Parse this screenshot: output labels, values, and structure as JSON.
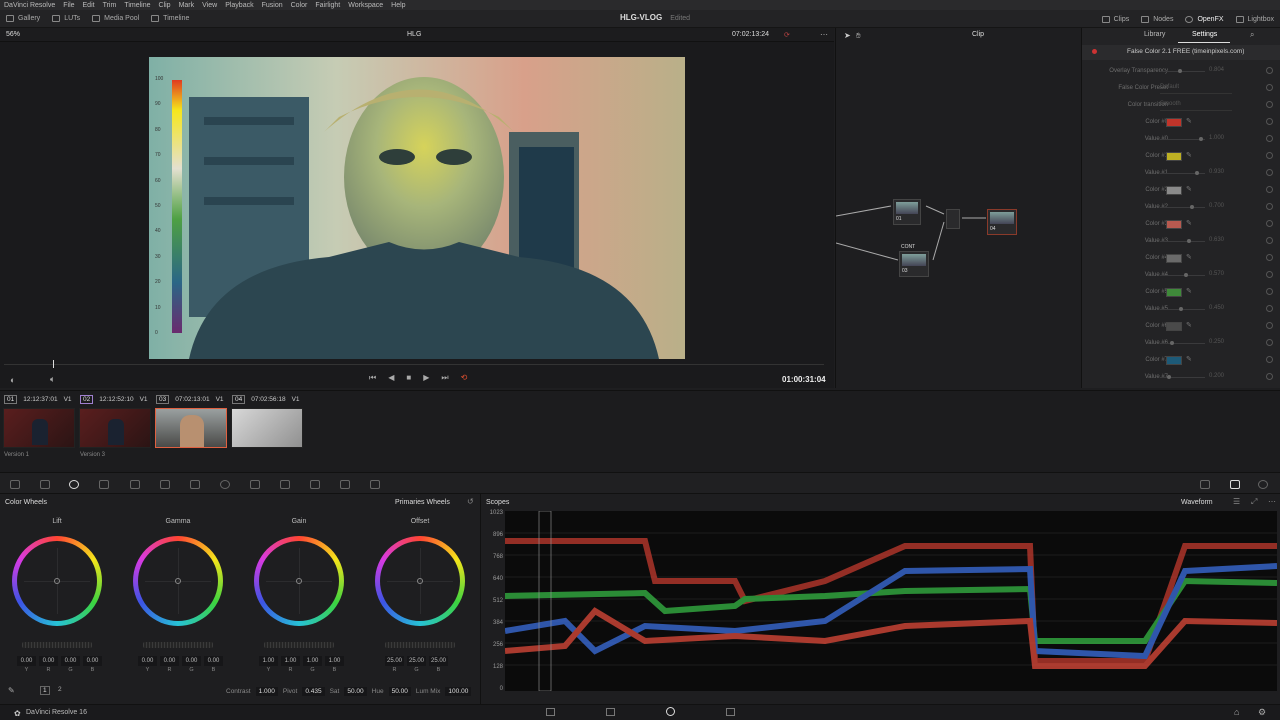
{
  "menu": [
    "DaVinci Resolve",
    "File",
    "Edit",
    "Trim",
    "Timeline",
    "Clip",
    "Mark",
    "View",
    "Playback",
    "Fusion",
    "Color",
    "Fairlight",
    "Workspace",
    "Help"
  ],
  "toolbar": {
    "left": [
      {
        "label": "Gallery",
        "icon": "gallery-icon"
      },
      {
        "label": "LUTs",
        "icon": "luts-icon"
      },
      {
        "label": "Media Pool",
        "icon": "media-pool-icon"
      },
      {
        "label": "Timeline",
        "icon": "timeline-icon"
      }
    ],
    "project_title": "HLG-VLOG",
    "project_status": "Edited",
    "right": [
      {
        "label": "Clips",
        "icon": "clips-icon"
      },
      {
        "label": "Nodes",
        "icon": "nodes-icon"
      },
      {
        "label": "OpenFX",
        "icon": "openfx-icon"
      },
      {
        "label": "Lightbox",
        "icon": "lightbox-icon"
      }
    ]
  },
  "viewer": {
    "zoom": "56%",
    "viewer_label": "HLG",
    "timecode_src": "07:02:13:24",
    "clip_mode": "Clip",
    "timecode": "01:00:31:04",
    "false_color_scale": [
      "100",
      "90",
      "80",
      "70",
      "60",
      "50",
      "40",
      "30",
      "20",
      "10",
      "0"
    ]
  },
  "nodes": {
    "labels": [
      "01",
      "02",
      "03",
      "04"
    ],
    "cont_label": "CONT"
  },
  "openfx": {
    "tabs": [
      "Library",
      "Settings"
    ],
    "plugin": "False Color 2.1 FREE (timeinpixels.com)",
    "rows": [
      {
        "label": "Overlay Transparency",
        "value": "0.804",
        "kind": "slider",
        "pos": 0.45
      },
      {
        "label": "False Color Preset",
        "value": "Default",
        "kind": "select"
      },
      {
        "label": "Color transition",
        "value": "Smooth",
        "kind": "select"
      },
      {
        "label": "Color #0",
        "kind": "color",
        "color": "#c0342a"
      },
      {
        "label": "Value #0",
        "value": "1.000",
        "kind": "slider",
        "pos": 0.9
      },
      {
        "label": "Color #1",
        "kind": "color",
        "color": "#bdb023"
      },
      {
        "label": "Value #1",
        "value": "0.930",
        "kind": "slider",
        "pos": 0.83
      },
      {
        "label": "Color #2",
        "kind": "color",
        "color": "#8a8a8a"
      },
      {
        "label": "Value #2",
        "value": "0.700",
        "kind": "slider",
        "pos": 0.72
      },
      {
        "label": "Color #3",
        "kind": "color",
        "color": "#b85a50"
      },
      {
        "label": "Value #3",
        "value": "0.630",
        "kind": "slider",
        "pos": 0.64
      },
      {
        "label": "Color #4",
        "kind": "color",
        "color": "#6a6a6a"
      },
      {
        "label": "Value #4",
        "value": "0.570",
        "kind": "slider",
        "pos": 0.58
      },
      {
        "label": "Color #5",
        "kind": "color",
        "color": "#3f8a3a"
      },
      {
        "label": "Value #5",
        "value": "0.450",
        "kind": "slider",
        "pos": 0.46
      },
      {
        "label": "Color #6",
        "kind": "color",
        "color": "#4a4a4a"
      },
      {
        "label": "Value #6",
        "value": "0.250",
        "kind": "slider",
        "pos": 0.26
      },
      {
        "label": "Color #7",
        "kind": "color",
        "color": "#1d5a78"
      },
      {
        "label": "Value #7",
        "value": "0.200",
        "kind": "slider",
        "pos": 0.2
      }
    ]
  },
  "clips": [
    {
      "num": "01",
      "tc": "12:12:37:01",
      "track": "V1",
      "version": "Version 1"
    },
    {
      "num": "02",
      "tc": "12:12:52:10",
      "track": "V1",
      "version": "Version 3"
    },
    {
      "num": "03",
      "tc": "07:02:13:01",
      "track": "V1",
      "version": ""
    },
    {
      "num": "04",
      "tc": "07:02:56:18",
      "track": "V1",
      "version": ""
    }
  ],
  "color_wheels": {
    "title": "Color Wheels",
    "mode": "Primaries Wheels",
    "wheels": [
      {
        "name": "Lift",
        "values": [
          "0.00",
          "0.00",
          "0.00",
          "0.00"
        ]
      },
      {
        "name": "Gamma",
        "values": [
          "0.00",
          "0.00",
          "0.00",
          "0.00"
        ]
      },
      {
        "name": "Gain",
        "values": [
          "1.00",
          "1.00",
          "1.00",
          "1.00"
        ]
      },
      {
        "name": "Offset",
        "values": [
          "25.00",
          "25.00",
          "25.00"
        ]
      }
    ],
    "channels": [
      "Y",
      "R",
      "G",
      "B"
    ],
    "channels_offset": [
      "R",
      "G",
      "B"
    ],
    "params": {
      "contrast_label": "Contrast",
      "contrast": "1.000",
      "pivot_label": "Pivot",
      "pivot": "0.435",
      "sat_label": "Sat",
      "sat": "50.00",
      "hue_label": "Hue",
      "hue": "50.00",
      "lummix_label": "Lum Mix",
      "lummix": "100.00"
    },
    "pages": [
      "1",
      "2"
    ]
  },
  "scopes": {
    "title": "Scopes",
    "mode": "Waveform",
    "y_ticks": [
      "1023",
      "896",
      "768",
      "640",
      "512",
      "384",
      "256",
      "128",
      "0"
    ]
  },
  "status": {
    "app": "DaVinci Resolve 16"
  }
}
